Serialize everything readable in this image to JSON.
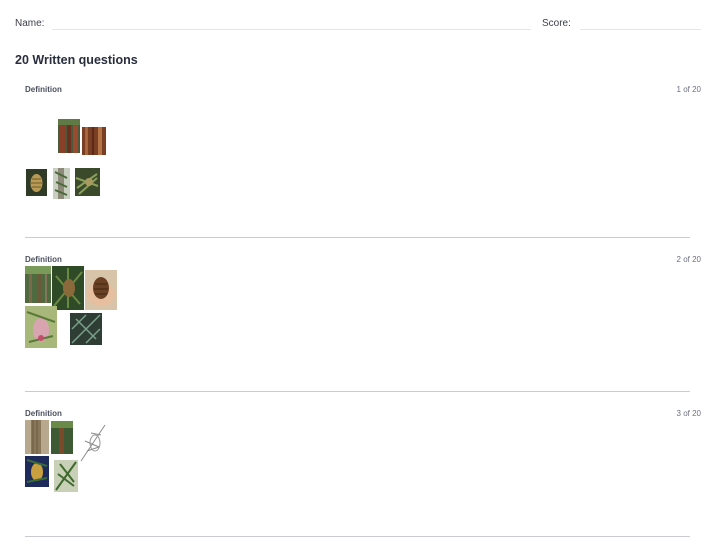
{
  "header": {
    "name_label": "Name:",
    "score_label": "Score:"
  },
  "section": {
    "title": "20 Written questions"
  },
  "questions": [
    {
      "type_label": "Definition",
      "counter": "1 of 20",
      "images": [
        "redwood-trunk-photo",
        "redwood-bark-photo",
        "cone-photo",
        "foliage-trunk-photo",
        "foliage-photo"
      ]
    },
    {
      "type_label": "Definition",
      "counter": "2 of 20",
      "images": [
        "forest-photo",
        "cone-branch-photo",
        "cone-in-hand-photo",
        "pink-cone-photo",
        "needles-photo"
      ]
    },
    {
      "type_label": "Definition",
      "counter": "3 of 20",
      "images": [
        "trunk-photo",
        "forest-photo",
        "botanical-sketch",
        "blue-cone-photo",
        "foliage-photo"
      ]
    }
  ]
}
